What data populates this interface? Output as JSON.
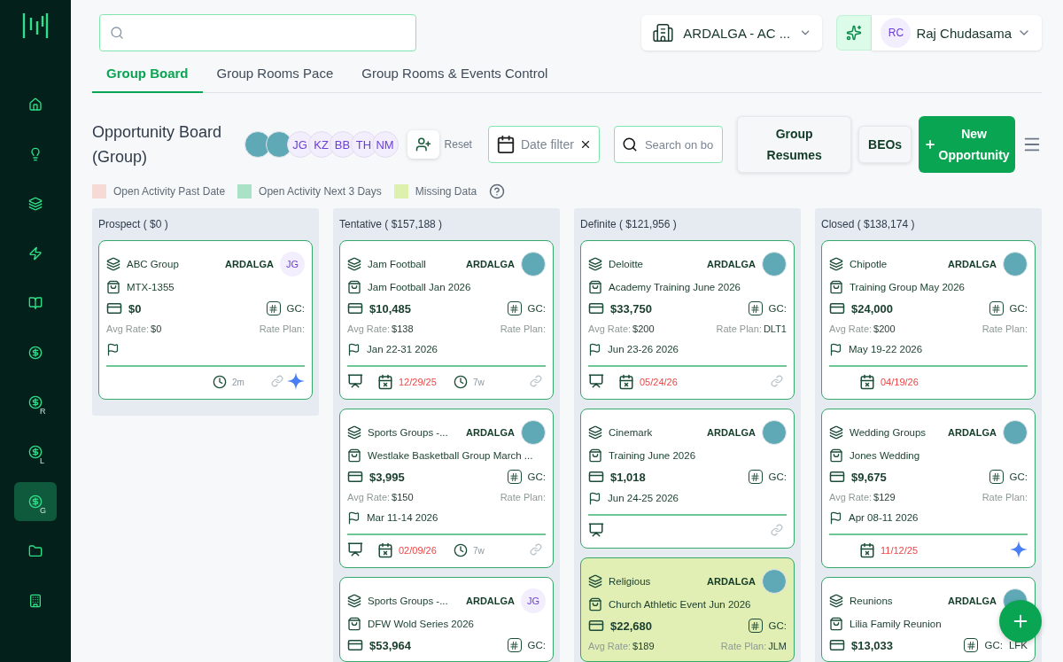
{
  "sidebar": {
    "items": [
      {
        "kind": "home",
        "selected": false
      },
      {
        "kind": "bulb",
        "selected": false
      },
      {
        "kind": "layers",
        "selected": false
      },
      {
        "kind": "bolt",
        "selected": false
      },
      {
        "kind": "book",
        "selected": false
      },
      {
        "kind": "dollar",
        "selected": false
      },
      {
        "kind": "dollar",
        "sub": "R",
        "selected": false
      },
      {
        "kind": "dollar",
        "sub": "L",
        "selected": false
      },
      {
        "kind": "dollar",
        "sub": "G",
        "selected": true
      },
      {
        "kind": "folder",
        "selected": false
      },
      {
        "kind": "building",
        "selected": false
      }
    ]
  },
  "topbar": {
    "property": "ARDALGA - AC ...",
    "user": {
      "initials": "RC",
      "name": "Raj Chudasama"
    }
  },
  "tabs": [
    {
      "label": "Group Board",
      "selected": true
    },
    {
      "label": "Group Rooms Pace",
      "selected": false
    },
    {
      "label": "Group Rooms & Events Control",
      "selected": false
    }
  ],
  "board": {
    "title": "Opportunity Board (Group)",
    "members": [
      {
        "kind": "photo"
      },
      {
        "kind": "photo"
      },
      {
        "kind": "initials",
        "text": "JG"
      },
      {
        "kind": "initials",
        "text": "KZ"
      },
      {
        "kind": "initials",
        "text": "BB"
      },
      {
        "kind": "initials",
        "text": "TH"
      },
      {
        "kind": "initials",
        "text": "NM"
      }
    ],
    "reset": "Reset",
    "date_filter": "Date filter",
    "search_placeholder": "Search on bo",
    "buttons": {
      "resumes": "Group Resumes",
      "beos": "BEOs",
      "new": "New Opportunity"
    },
    "legend": [
      {
        "label": "Open Activity Past Date",
        "color": "#f7d9d6"
      },
      {
        "label": "Open Activity Next 3 Days",
        "color": "#a9e2c6"
      },
      {
        "label": "Missing Data",
        "color": "#def0ad"
      }
    ]
  },
  "columns": [
    {
      "title": "Prospect ( $0 )",
      "cards": [
        {
          "account": "ABC Group",
          "brand": "ARDALGA",
          "owner": {
            "kind": "initials",
            "text": "JG"
          },
          "opportunity": "MTX-1355",
          "amount": "$0",
          "gc": {
            "label": "GC:"
          },
          "avg_rate": {
            "label": "Avg Rate:",
            "value": "$0"
          },
          "rate_plan": {
            "label": "Rate Plan:"
          },
          "flag": true,
          "missing_data": false,
          "footer": {
            "presenter": false,
            "age": "2m",
            "link": true,
            "ai": true
          }
        }
      ]
    },
    {
      "title": "Tentative ( $157,188 )",
      "cards": [
        {
          "account": "Jam Football",
          "brand": "ARDALGA",
          "owner": {
            "kind": "photo"
          },
          "opportunity": "Jam Football Jan 2026",
          "amount": "$10,485",
          "gc": {
            "label": "GC:"
          },
          "avg_rate": {
            "label": "Avg Rate:",
            "value": "$138"
          },
          "rate_plan": {
            "label": "Rate Plan:"
          },
          "flag": true,
          "dates": "Jan 22-31 2026",
          "missing_data": false,
          "footer": {
            "presenter": true,
            "due": "12/29/25",
            "age": "7w",
            "link": true,
            "ai": false
          }
        },
        {
          "account": "Sports Groups -...",
          "brand": "ARDALGA",
          "owner": {
            "kind": "photo"
          },
          "opportunity": "Westlake Basketball Group March ...",
          "amount": "$3,995",
          "gc": {
            "label": "GC:"
          },
          "avg_rate": {
            "label": "Avg Rate:",
            "value": "$150"
          },
          "rate_plan": {
            "label": "Rate Plan:"
          },
          "flag": true,
          "dates": "Mar 11-14 2026",
          "missing_data": false,
          "footer": {
            "presenter": true,
            "due": "02/09/26",
            "age": "7w",
            "link": true,
            "ai": false
          }
        },
        {
          "account": "Sports Groups -...",
          "brand": "ARDALGA",
          "owner": {
            "kind": "initials",
            "text": "JG"
          },
          "opportunity": "DFW Wold Series 2026",
          "amount": "$53,964",
          "gc": {
            "label": "GC:"
          },
          "flag": false,
          "missing_data": false
        }
      ]
    },
    {
      "title": "Definite ( $121,956 )",
      "cards": [
        {
          "account": "Deloitte",
          "brand": "ARDALGA",
          "owner": {
            "kind": "photo"
          },
          "opportunity": "Academy Training June 2026",
          "amount": "$33,750",
          "gc": {
            "label": "GC:"
          },
          "avg_rate": {
            "label": "Avg Rate:",
            "value": "$200"
          },
          "rate_plan": {
            "label": "Rate Plan:",
            "value": "DLT1"
          },
          "flag": true,
          "dates": "Jun 23-26 2026",
          "missing_data": false,
          "footer": {
            "presenter": true,
            "due": "05/24/26",
            "link": true,
            "ai": false
          }
        },
        {
          "account": "Cinemark",
          "brand": "ARDALGA",
          "owner": {
            "kind": "photo"
          },
          "opportunity": "Training June 2026",
          "amount": "$1,018",
          "gc": {
            "label": "GC:"
          },
          "flag": true,
          "dates": "Jun 24-25 2026",
          "missing_data": false,
          "footer": {
            "presenter": true,
            "link": true,
            "ai": false
          }
        },
        {
          "account": "Religious",
          "brand": "ARDALGA",
          "owner": {
            "kind": "photo"
          },
          "opportunity": "Church Athletic Event Jun 2026",
          "amount": "$22,680",
          "gc": {
            "label": "GC:"
          },
          "avg_rate": {
            "label": "Avg Rate:",
            "value": "$189"
          },
          "rate_plan": {
            "label": "Rate Plan:",
            "value": "JLM"
          },
          "flag": false,
          "missing_data": true
        }
      ]
    },
    {
      "title": "Closed ( $138,174 )",
      "cards": [
        {
          "account": "Chipotle",
          "brand": "ARDALGA",
          "owner": {
            "kind": "photo"
          },
          "opportunity": "Training Group May 2026",
          "amount": "$24,000",
          "gc": {
            "label": "GC:"
          },
          "avg_rate": {
            "label": "Avg Rate:",
            "value": "$200"
          },
          "rate_plan": {
            "label": "Rate Plan:"
          },
          "flag": true,
          "dates": "May 19-22 2026",
          "missing_data": false,
          "footer": {
            "presenter": false,
            "due": "04/19/26",
            "link": false,
            "ai": false
          }
        },
        {
          "account": "Wedding Groups",
          "brand": "ARDALGA",
          "owner": {
            "kind": "photo"
          },
          "opportunity": "Jones Wedding",
          "amount": "$9,675",
          "gc": {
            "label": "GC:"
          },
          "avg_rate": {
            "label": "Avg Rate:",
            "value": "$129"
          },
          "rate_plan": {
            "label": "Rate Plan:"
          },
          "flag": true,
          "dates": "Apr 08-11 2026",
          "missing_data": false,
          "footer": {
            "presenter": false,
            "due": "11/12/25",
            "link": false,
            "ai": true
          }
        },
        {
          "account": "Reunions",
          "brand": "ARDALGA",
          "owner": {
            "kind": "photo"
          },
          "opportunity": "Lilia Family Reunion",
          "amount": "$13,033",
          "gc": {
            "label": "GC:",
            "value": "LFK"
          },
          "flag": false,
          "missing_data": false
        }
      ]
    }
  ]
}
